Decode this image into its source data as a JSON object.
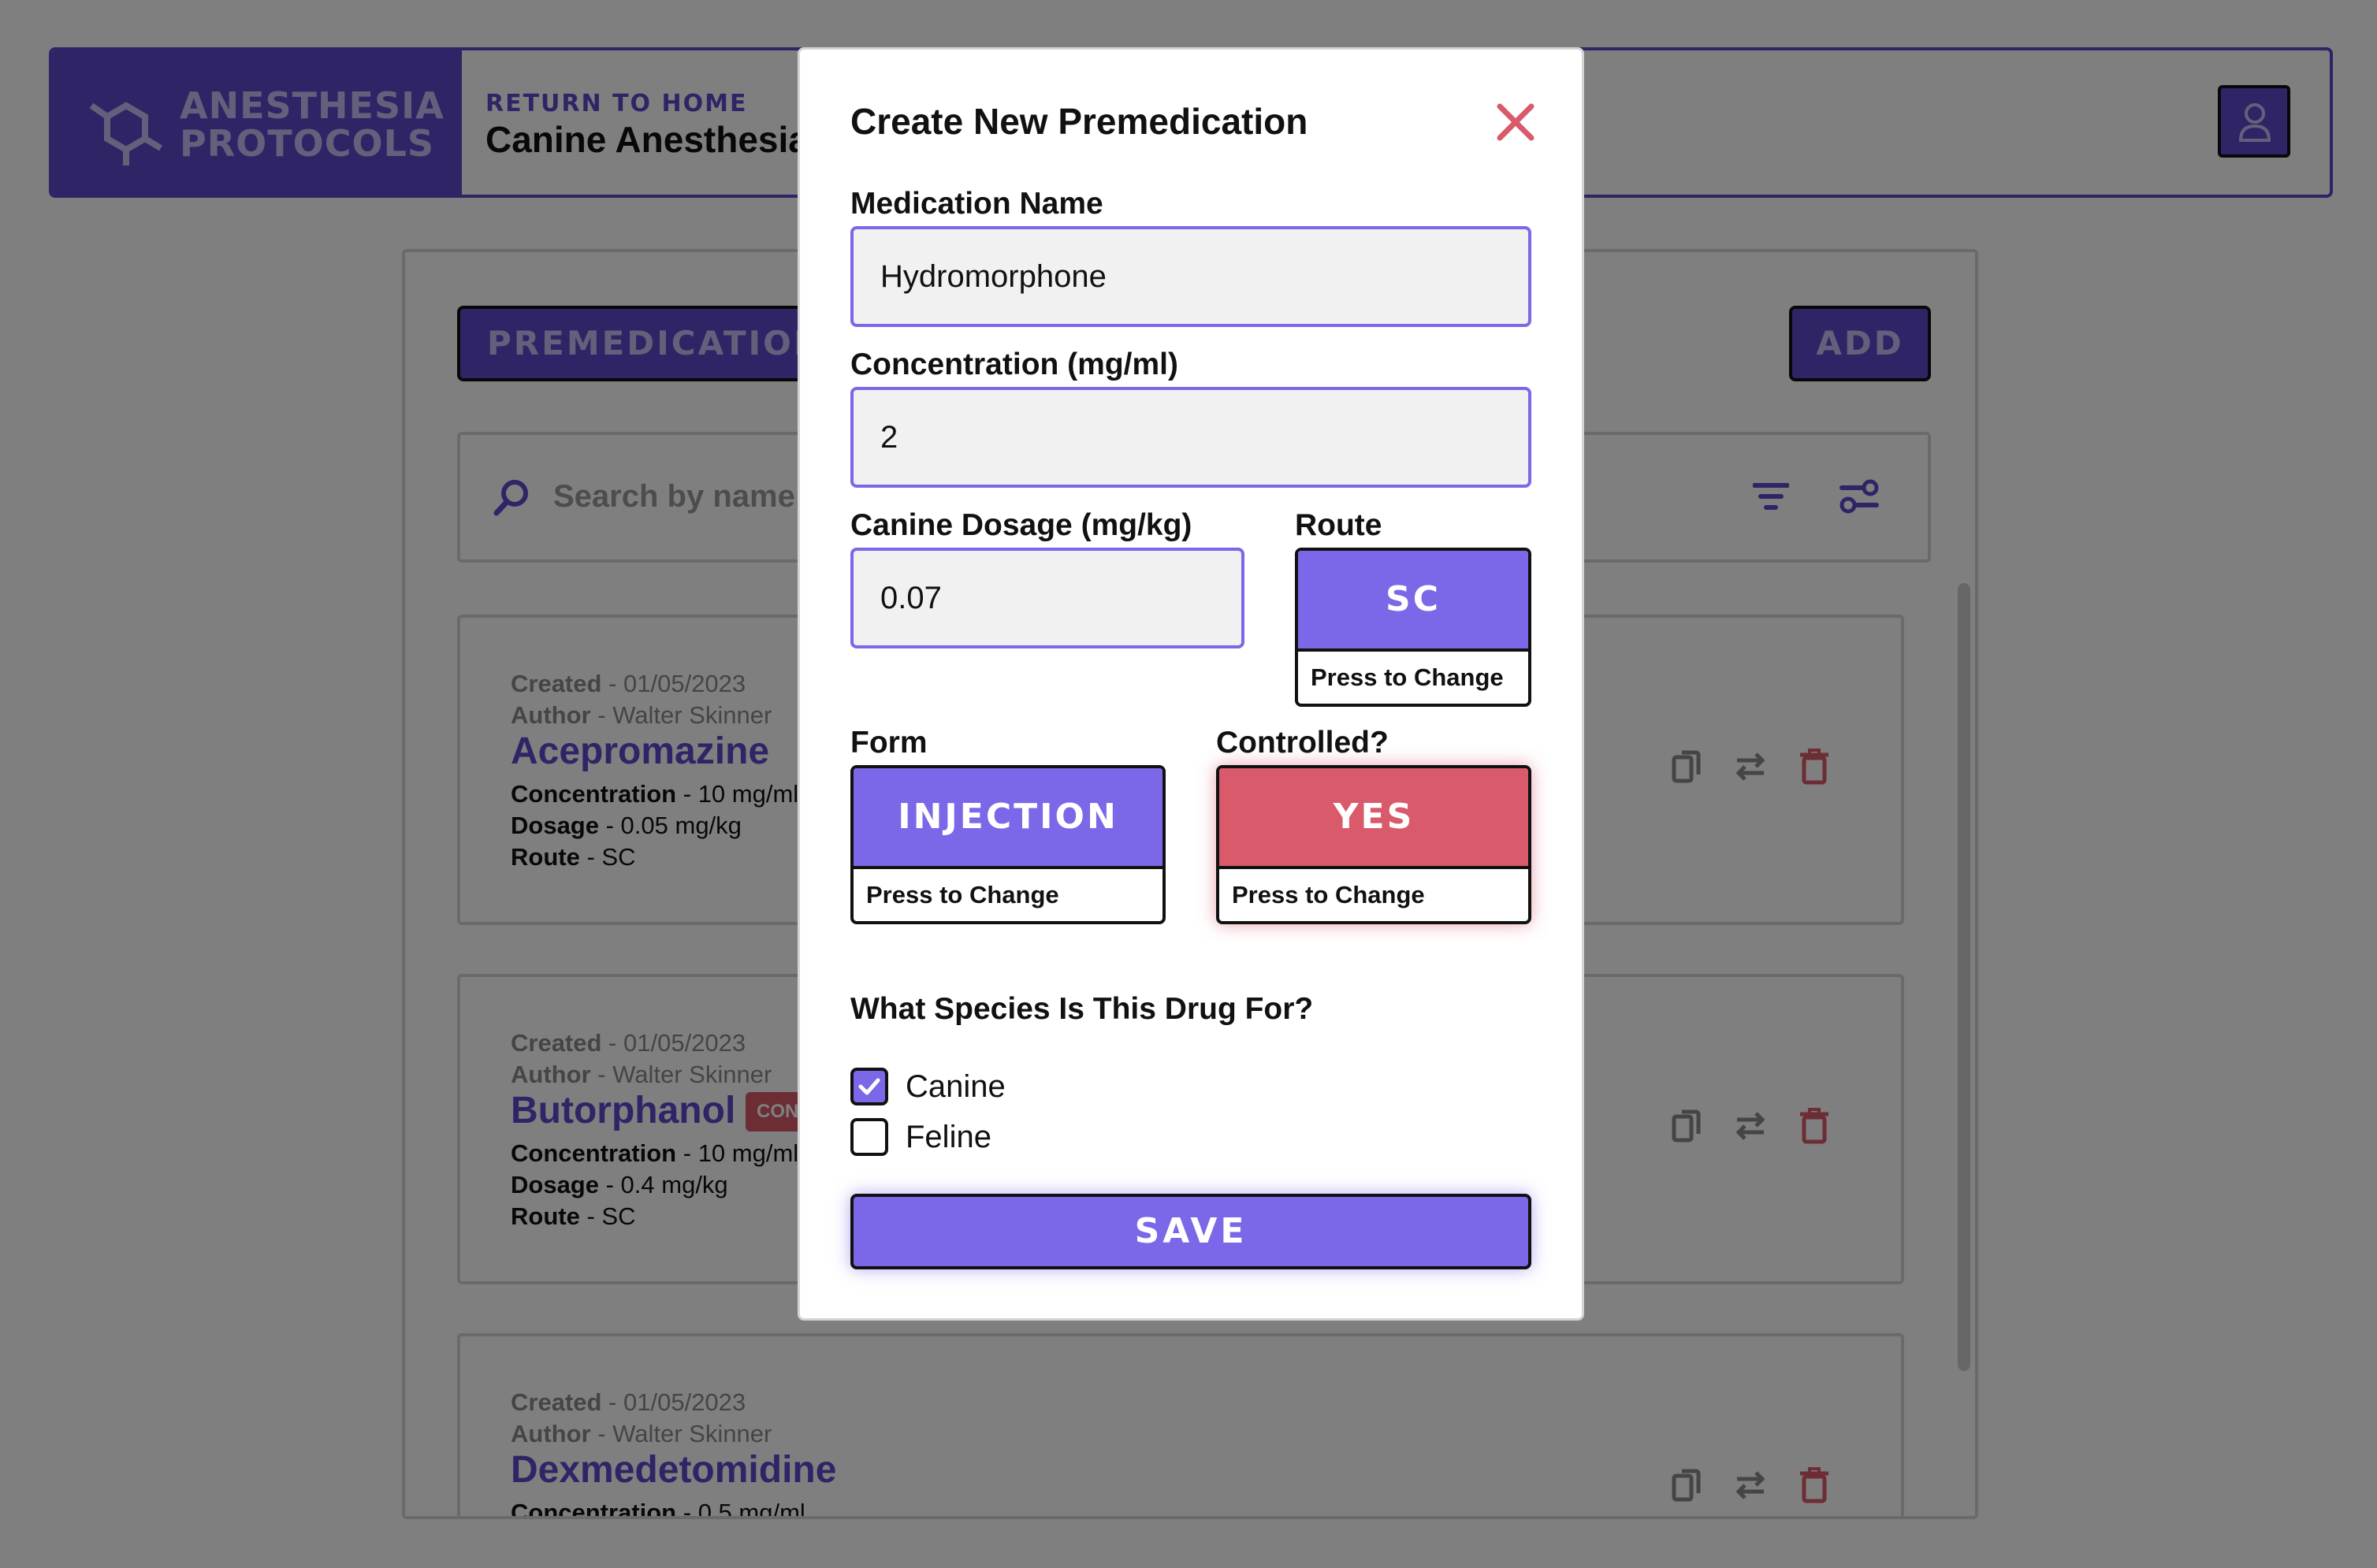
{
  "header": {
    "logo_line1": "ANESTHESIA",
    "logo_line2": "PROTOCOLS",
    "return_link": "RETURN TO HOME",
    "title": "Canine Anesthesia Protocols"
  },
  "panel": {
    "section_title": "PREMEDICATIONS",
    "add_label": "ADD",
    "search_placeholder": "Search by name"
  },
  "cards": [
    {
      "created_label": "Created",
      "created": "01/05/2023",
      "author_label": "Author",
      "author": "Walter Skinner",
      "name": "Acepromazine",
      "concentration_label": "Concentration",
      "concentration": "10 mg/ml",
      "dosage_label": "Dosage",
      "dosage": "0.05 mg/kg",
      "route_label": "Route",
      "route": "SC"
    },
    {
      "created_label": "Created",
      "created": "01/05/2023",
      "author_label": "Author",
      "author": "Walter Skinner",
      "name": "Butorphanol",
      "badge": "CONTROLLED",
      "concentration_label": "Concentration",
      "concentration": "10 mg/ml",
      "dosage_label": "Dosage",
      "dosage": "0.4 mg/kg",
      "route_label": "Route",
      "route": "SC"
    },
    {
      "created_label": "Created",
      "created": "01/05/2023",
      "author_label": "Author",
      "author": "Walter Skinner",
      "name": "Dexmedetomidine",
      "concentration_label": "Concentration",
      "concentration": "0.5 mg/ml"
    }
  ],
  "modal": {
    "title": "Create New Premedication",
    "name_label": "Medication Name",
    "name_value": "Hydromorphone",
    "concentration_label": "Concentration (mg/ml)",
    "concentration_value": "2",
    "dosage_label": "Canine Dosage (mg/kg)",
    "dosage_value": "0.07",
    "route_label": "Route",
    "route_value": "SC",
    "form_label": "Form",
    "form_value": "INJECTION",
    "controlled_label": "Controlled?",
    "controlled_value": "YES",
    "press_to_change": "Press to Change",
    "species_label": "What Species Is This Drug For?",
    "species": [
      {
        "label": "Canine",
        "checked": true
      },
      {
        "label": "Feline",
        "checked": false
      }
    ],
    "save_label": "SAVE"
  },
  "colors": {
    "brand": "#5f4bcc",
    "accent": "#7a68e8",
    "danger": "#d95a6b"
  }
}
